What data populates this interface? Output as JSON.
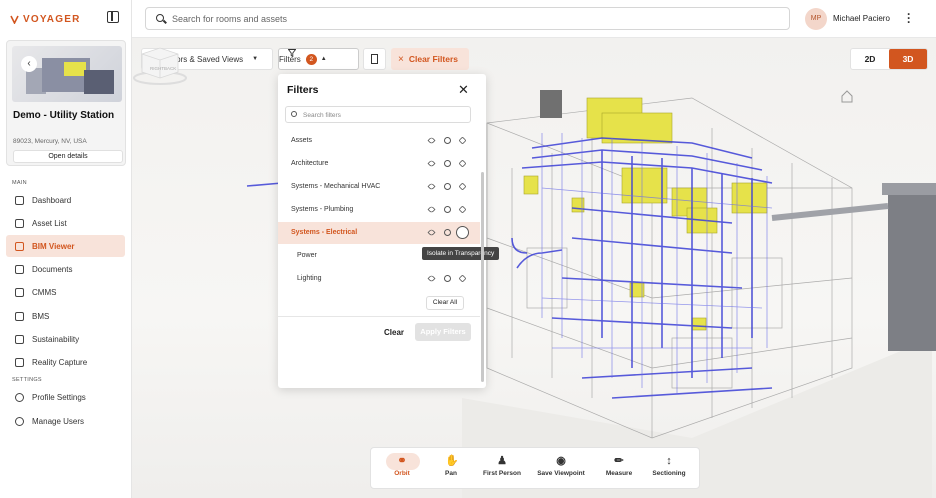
{
  "app": {
    "brand": "VOYAGER"
  },
  "site": {
    "name": "Demo - Utility Station",
    "address": "89023, Mercury, NV, USA",
    "open_details": "Open details"
  },
  "sidebar": {
    "main_label": "MAIN",
    "settings_label": "SETTINGS",
    "main_items": [
      {
        "label": "Dashboard",
        "icon": "dashboard-icon"
      },
      {
        "label": "Asset List",
        "icon": "asset-list-icon"
      },
      {
        "label": "BIM Viewer",
        "icon": "bim-viewer-icon",
        "active": true
      },
      {
        "label": "Documents",
        "icon": "folder-icon"
      },
      {
        "label": "CMMS",
        "icon": "cmms-icon"
      },
      {
        "label": "BMS",
        "icon": "bms-icon"
      },
      {
        "label": "Sustainability",
        "icon": "sustainability-icon"
      },
      {
        "label": "Reality Capture",
        "icon": "reality-capture-icon"
      }
    ],
    "settings_items": [
      {
        "label": "Profile Settings",
        "icon": "profile-icon"
      },
      {
        "label": "Manage Users",
        "icon": "manage-users-icon"
      }
    ]
  },
  "header": {
    "search_placeholder": "Search for rooms and assets",
    "user_initials": "MP",
    "user_name": "Michael Paciero"
  },
  "viewer_toolbar": {
    "floors_label": "Floors & Saved Views",
    "filters_label": "Filters",
    "filters_count": "2",
    "clear_filters": "Clear Filters",
    "view_2d": "2D",
    "view_3d": "3D",
    "active_view": "3D"
  },
  "filters_panel": {
    "title": "Filters",
    "search_placeholder": "Search filters",
    "rows": [
      {
        "label": "Assets"
      },
      {
        "label": "Architecture"
      },
      {
        "label": "Systems - Mechanical HVAC"
      },
      {
        "label": "Systems - Plumbing"
      },
      {
        "label": "Systems - Electrical",
        "selected": true
      },
      {
        "label": "Power",
        "sub": true
      },
      {
        "label": "Lighting",
        "sub": true
      }
    ],
    "tooltip": "Isolate in Transparency",
    "clear_all": "Clear All",
    "clear": "Clear",
    "apply": "Apply Filters"
  },
  "viewcube": {
    "right": "RIGHT",
    "back": "BACK"
  },
  "bottom_tools": [
    {
      "label": "Orbit",
      "icon": "orbit-icon",
      "active": true
    },
    {
      "label": "Pan",
      "icon": "hand-icon"
    },
    {
      "label": "First Person",
      "icon": "person-icon"
    },
    {
      "label": "Save Viewpoint",
      "icon": "camera-icon"
    },
    {
      "label": "Measure",
      "icon": "ruler-icon"
    },
    {
      "label": "Sectioning",
      "icon": "sectioning-icon"
    }
  ],
  "colors": {
    "accent": "#d2561f",
    "accent_light": "#f8e3da",
    "electrical": "#3b3fd6",
    "equipment": "#e6e24a"
  }
}
